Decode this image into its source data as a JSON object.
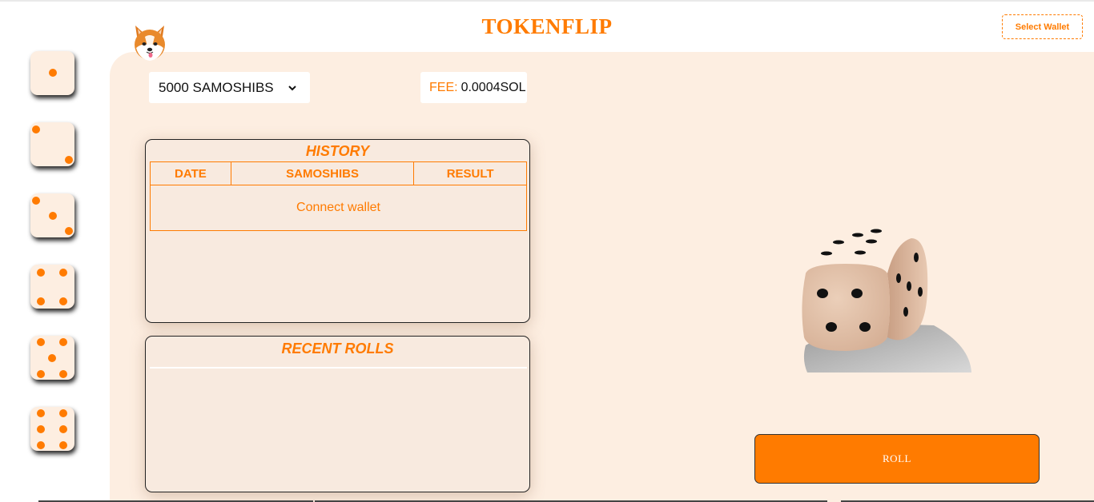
{
  "header": {
    "title": "TOKENFLIP",
    "wallet_button": "Select Wallet"
  },
  "logo": {
    "icon": "shiba-inu-logo-icon"
  },
  "dice_sidebar": [
    {
      "face": 1
    },
    {
      "face": 2
    },
    {
      "face": 3
    },
    {
      "face": 4
    },
    {
      "face": 5
    },
    {
      "face": 6
    }
  ],
  "bet": {
    "selected": "5000 SAMOSHIBS"
  },
  "fee": {
    "label": "FEE:",
    "value": "0.0004SOL"
  },
  "history": {
    "title": "HISTORY",
    "columns": [
      "DATE",
      "SAMOSHIBS",
      "RESULT"
    ],
    "empty_message": "Connect wallet"
  },
  "recent_rolls": {
    "title": "RECENT ROLLS"
  },
  "roll_button": "ROLL",
  "colors": {
    "accent": "#ff7b00",
    "panel": "#fdeee1",
    "card": "#f8eadf"
  }
}
